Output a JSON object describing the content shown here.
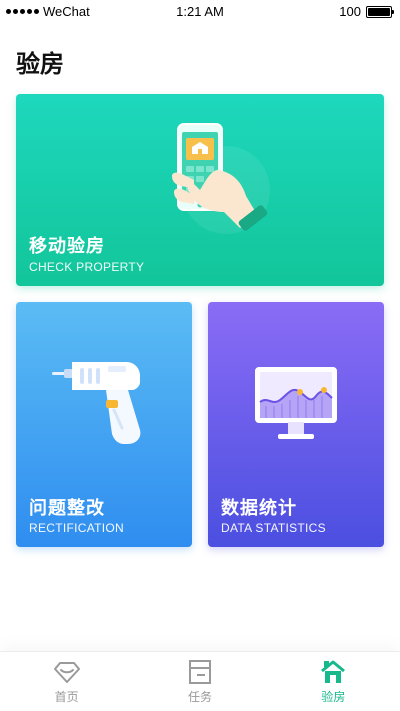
{
  "status_bar": {
    "carrier": "WeChat",
    "time": "1:21 AM",
    "battery_level": "100"
  },
  "page": {
    "title": "验房"
  },
  "cards": {
    "check_property": {
      "title": "移动验房",
      "subtitle": "CHECK PROPERTY",
      "icon": "phone-in-hand-icon",
      "color": "#12c59a"
    },
    "rectification": {
      "title": "问题整改",
      "subtitle": "RECTIFICATION",
      "icon": "drill-icon",
      "color": "#2f8df0"
    },
    "data_statistics": {
      "title": "数据统计",
      "subtitle": "DATA STATISTICS",
      "icon": "monitor-chart-icon",
      "color": "#4b4fe0"
    }
  },
  "tab_bar": {
    "active_color": "#17b98c",
    "items": [
      {
        "label": "首页",
        "icon": "diamond-home-icon",
        "active": false
      },
      {
        "label": "任务",
        "icon": "task-doc-icon",
        "active": false
      },
      {
        "label": "验房",
        "icon": "house-check-icon",
        "active": true
      }
    ]
  }
}
